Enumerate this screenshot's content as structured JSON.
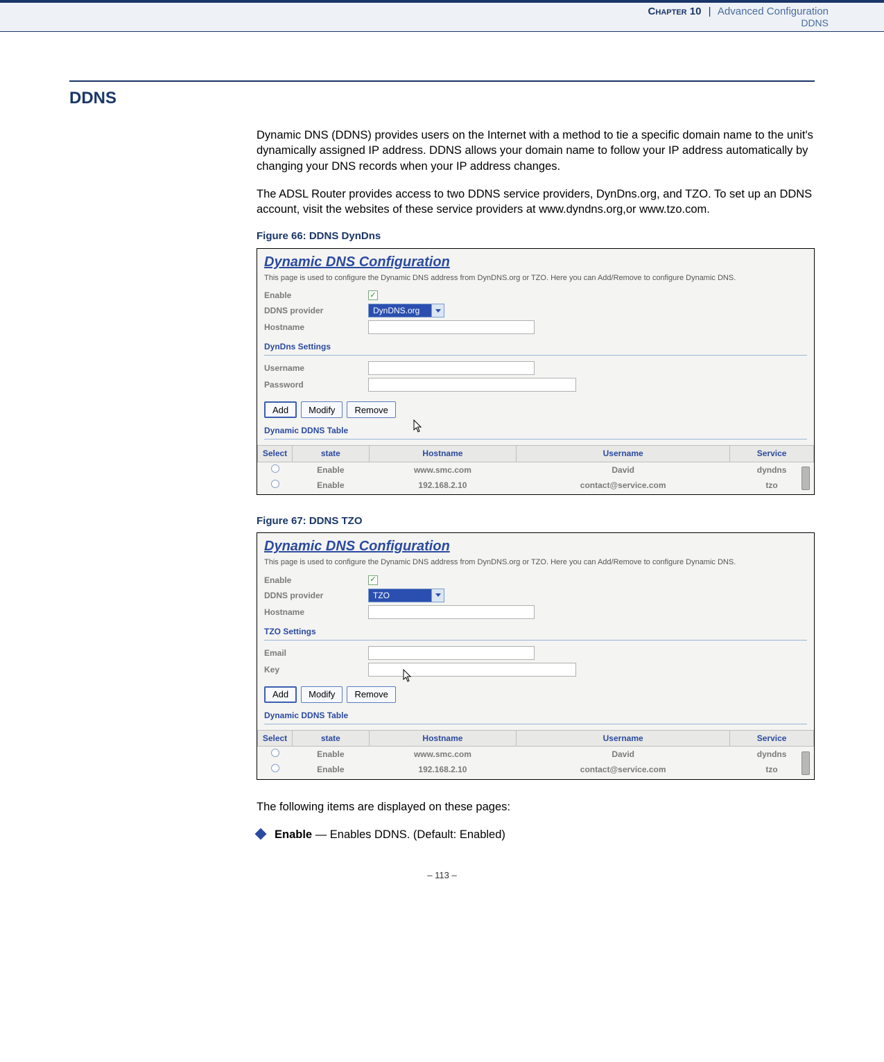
{
  "header": {
    "chapter_label": "Chapter 10",
    "chapter_title": "Advanced Configuration",
    "subsection": "DDNS"
  },
  "section_heading": "DDNS",
  "paragraphs": {
    "p1": "Dynamic DNS (DDNS) provides users on the Internet with a method to tie a specific domain name to the unit's dynamically assigned IP address. DDNS allows your domain name to follow your IP address automatically by changing your DNS records when your IP address changes.",
    "p2": "The ADSL Router provides access to two DDNS service providers, DynDns.org, and TZO. To set up an DDNS account, visit the websites of these service providers at www.dyndns.org,or www.tzo.com."
  },
  "figures": {
    "f66_caption": "Figure 66:  DDNS DynDns",
    "f67_caption": "Figure 67:  DDNS TZO"
  },
  "screenshot_common": {
    "panel_title": "Dynamic DNS Configuration",
    "panel_desc": "This page is used to configure the Dynamic DNS address from DynDNS.org or TZO. Here you can Add/Remove to configure Dynamic DNS.",
    "labels": {
      "enable": "Enable",
      "provider": "DDNS provider",
      "hostname": "Hostname"
    },
    "buttons": {
      "add": "Add",
      "modify": "Modify",
      "remove": "Remove"
    },
    "table_heading": "Dynamic DDNS Table",
    "table_headers": {
      "select": "Select",
      "state": "state",
      "hostname": "Hostname",
      "username": "Username",
      "service": "Service"
    },
    "rows": [
      {
        "state": "Enable",
        "hostname": "www.smc.com",
        "username": "David",
        "service": "dyndns"
      },
      {
        "state": "Enable",
        "hostname": "192.168.2.10",
        "username": "contact@service.com",
        "service": "tzo"
      }
    ]
  },
  "shot1": {
    "provider_value": "DynDNS.org",
    "sub_heading": "DynDns Settings",
    "labels": {
      "username": "Username",
      "password": "Password"
    }
  },
  "shot2": {
    "provider_value": "TZO",
    "sub_heading": "TZO Settings",
    "labels": {
      "email": "Email",
      "key": "Key"
    }
  },
  "items_intro": "The following items are displayed on these pages:",
  "bullet1_label": "Enable",
  "bullet1_text": " — Enables DDNS. (Default: Enabled)",
  "page_number": "–  113  –"
}
